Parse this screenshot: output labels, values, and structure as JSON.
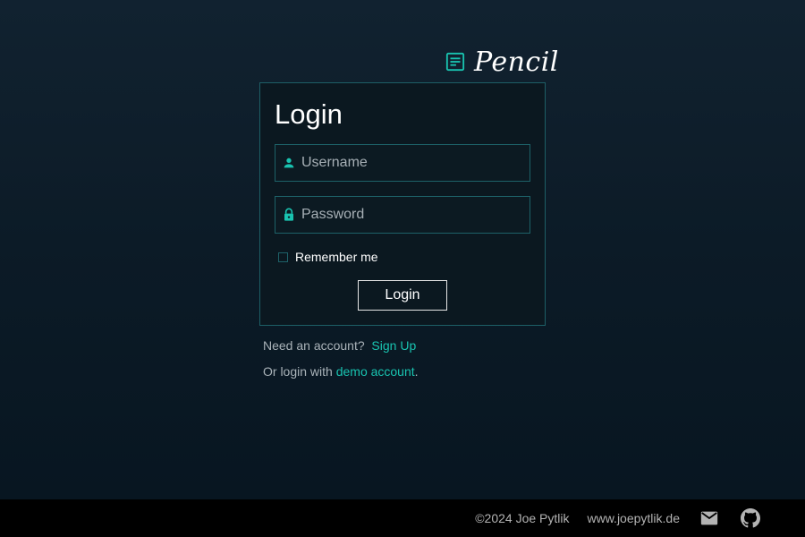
{
  "brand": {
    "name": "Pencil",
    "icon": "note-icon"
  },
  "login": {
    "title": "Login",
    "username": {
      "placeholder": "Username",
      "value": "",
      "icon": "person-icon"
    },
    "password": {
      "placeholder": "Password",
      "value": "",
      "icon": "lock-icon"
    },
    "remember_label": "Remember me",
    "remember_checked": false,
    "submit_label": "Login"
  },
  "links": {
    "need_account": "Need an account?",
    "sign_up": "Sign Up",
    "or_login_with": "Or login with",
    "demo_account": "demo account",
    "period": "."
  },
  "footer": {
    "copyright": "©2024 Joe Pytlik",
    "website": "www.joepytlik.de",
    "icons": [
      "mail-icon",
      "github-icon"
    ]
  },
  "colors": {
    "accent": "#19c3b0",
    "border": "#1d6168",
    "background": "#0c1b27",
    "footer": "#000000"
  }
}
